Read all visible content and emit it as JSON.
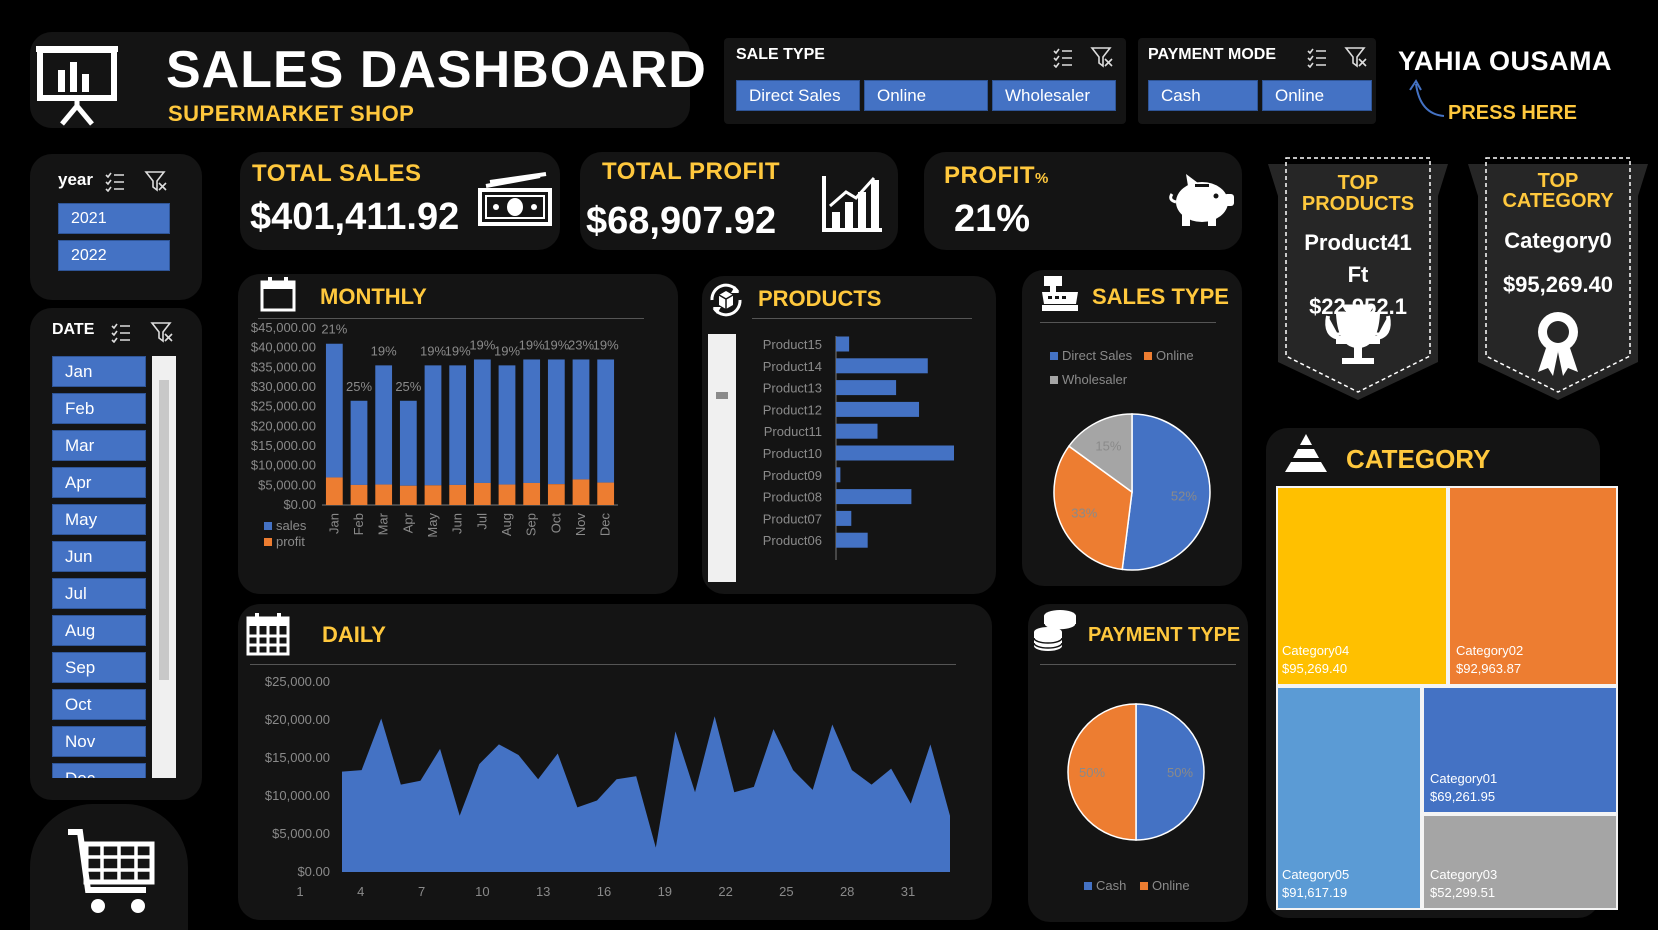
{
  "header": {
    "title": "SALES DASHBOARD",
    "subtitle": "SUPERMARKET SHOP",
    "author": "YAHIA OUSAMA",
    "press_here": "PRESS HERE"
  },
  "slicers": {
    "sale_type": {
      "title": "SALE TYPE",
      "items": [
        "Direct Sales",
        "Online",
        "Wholesaler"
      ]
    },
    "payment_mode": {
      "title": "PAYMENT MODE",
      "items": [
        "Cash",
        "Online"
      ]
    },
    "year": {
      "title": "year",
      "items": [
        "2021",
        "2022"
      ]
    },
    "date": {
      "title": "DATE",
      "items": [
        "Jan",
        "Feb",
        "Mar",
        "Apr",
        "May",
        "Jun",
        "Jul",
        "Aug",
        "Sep",
        "Oct",
        "Nov",
        "Dec"
      ]
    }
  },
  "kpis": {
    "total_sales": {
      "title": "TOTAL SALES",
      "value": "$401,411.92"
    },
    "total_profit": {
      "title": "TOTAL PROFIT",
      "value": "$68,907.92"
    },
    "profit_pct": {
      "title": "PROFIT",
      "title_suffix": "%",
      "value": "21%"
    }
  },
  "top_products": {
    "title_line1": "TOP",
    "title_line2": "PRODUCTS",
    "name_line1": "Product41",
    "name_line2": "Ft",
    "value": "$22,952.1"
  },
  "top_category": {
    "title_line1": "TOP",
    "title_line2": "CATEGORY",
    "name": "Category0",
    "value": "$95,269.40"
  },
  "panels": {
    "monthly": "MONTHLY",
    "products": "PRODUCTS",
    "sales_type": "SALES TYPE",
    "daily": "DAILY",
    "payment_type": "PAYMENT TYPE",
    "category": "CATEGORY"
  },
  "colors": {
    "accent": "#FFC83D",
    "blue": "#4472C4",
    "orange": "#ED7D31",
    "gray": "#A5A5A5",
    "gold": "#FFC000",
    "light_blue": "#5B9BD5",
    "panel": "#141414"
  },
  "chart_data": [
    {
      "type": "bar",
      "name": "monthly",
      "categories": [
        "Jan",
        "Feb",
        "Mar",
        "Apr",
        "May",
        "Jun",
        "Jul",
        "Aug",
        "Sep",
        "Oct",
        "Nov",
        "Dec"
      ],
      "series": [
        {
          "name": "sales",
          "values": [
            41000,
            26500,
            35500,
            26500,
            35500,
            35500,
            37000,
            35500,
            37000,
            37000,
            37000,
            37000
          ]
        },
        {
          "name": "profit",
          "values": [
            7000,
            5100,
            5200,
            4900,
            5000,
            5100,
            5600,
            5200,
            5600,
            5300,
            6500,
            5700
          ]
        }
      ],
      "data_labels": [
        "21%",
        "25%",
        "19%",
        "25%",
        "19%",
        "19%",
        "19%",
        "19%",
        "19%",
        "19%",
        "23%",
        "19%"
      ],
      "yticks": [
        "$0.00",
        "$5,000.00",
        "$10,000.00",
        "$15,000.00",
        "$20,000.00",
        "$25,000.00",
        "$30,000.00",
        "$35,000.00",
        "$40,000.00",
        "$45,000.00"
      ],
      "ylim": [
        0,
        45000
      ],
      "legend": [
        "sales",
        "profit"
      ]
    },
    {
      "type": "bar",
      "name": "products",
      "orientation": "horizontal",
      "categories": [
        "Product15",
        "Product14",
        "Product13",
        "Product12",
        "Product11",
        "Product10",
        "Product09",
        "Product08",
        "Product07",
        "Product06"
      ],
      "values": [
        1200,
        8400,
        5500,
        7600,
        3800,
        10800,
        400,
        6900,
        1400,
        2900
      ]
    },
    {
      "type": "pie",
      "name": "sales_type",
      "labels": [
        "Direct Sales",
        "Online",
        "Wholesaler"
      ],
      "values": [
        52,
        33,
        15
      ],
      "data_labels": [
        "52%",
        "33%",
        "15%"
      ]
    },
    {
      "type": "area",
      "name": "daily",
      "x": [
        1,
        2,
        3,
        4,
        5,
        6,
        7,
        8,
        9,
        10,
        11,
        12,
        13,
        14,
        15,
        16,
        17,
        18,
        19,
        20,
        21,
        22,
        23,
        24,
        25,
        26,
        27,
        28,
        29,
        30,
        31
      ],
      "values": [
        13200,
        13400,
        20200,
        11500,
        12000,
        16200,
        7400,
        14200,
        16800,
        15400,
        12200,
        15600,
        8500,
        9400,
        12200,
        12600,
        3200,
        18500,
        10500,
        20500,
        10500,
        11200,
        18800,
        13400,
        10800,
        19400,
        13400,
        11500,
        13600,
        9000,
        16800,
        7400
      ],
      "xticks": [
        "1",
        "4",
        "7",
        "10",
        "13",
        "16",
        "19",
        "22",
        "25",
        "28",
        "31"
      ],
      "yticks": [
        "$0.00",
        "$5,000.00",
        "$10,000.00",
        "$15,000.00",
        "$20,000.00",
        "$25,000.00"
      ],
      "ylim": [
        0,
        25000
      ]
    },
    {
      "type": "pie",
      "name": "payment_type",
      "labels": [
        "Cash",
        "Online"
      ],
      "values": [
        50,
        50
      ],
      "data_labels": [
        "50%",
        "50%"
      ]
    },
    {
      "type": "treemap",
      "name": "category",
      "items": [
        {
          "label": "Category04",
          "value": "$95,269.40"
        },
        {
          "label": "Category02",
          "value": "$92,963.87"
        },
        {
          "label": "Category05",
          "value": "$91,617.19"
        },
        {
          "label": "Category01",
          "value": "$69,261.95"
        },
        {
          "label": "Category03",
          "value": "$52,299.51"
        }
      ]
    }
  ]
}
